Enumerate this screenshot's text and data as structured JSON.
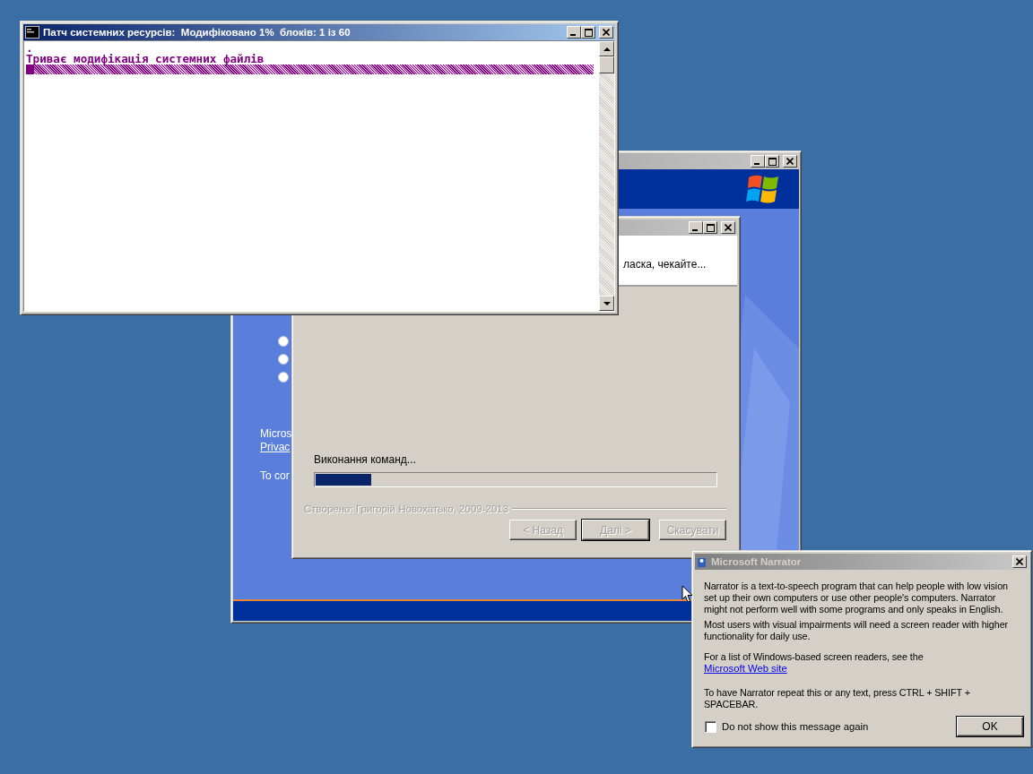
{
  "setup_window": {
    "active": false,
    "options": [
      {
        "selected": false
      },
      {
        "selected": false
      },
      {
        "selected": false
      }
    ],
    "texts": [
      {
        "kind": "text",
        "text": "Micros"
      },
      {
        "kind": "link",
        "text": "Privac"
      },
      {
        "kind": "gap"
      },
      {
        "kind": "text",
        "text": "To cor"
      }
    ]
  },
  "wizard_window": {
    "active": false,
    "header_text": "ласка, чекайте...",
    "status_text": "Виконання команд...",
    "progress": {
      "level": 0.14
    },
    "credit": "Створено: Григорій Новохатько, 2009-2013",
    "buttons": [
      {
        "label": "< Назад",
        "disabled": true,
        "default": false
      },
      {
        "label": "Далі >",
        "disabled": true,
        "default": true
      },
      {
        "label": "Скасувати",
        "disabled": true,
        "default": false
      }
    ]
  },
  "console_window": {
    "active": true,
    "title": "Патч системних ресурсів:  Модифіковано 1%  блоків: 1 із 60",
    "lines": [
      ".",
      "Триває модифікація системних файлів"
    ],
    "progress": {
      "level": 0.015
    }
  },
  "narrator_window": {
    "active": false,
    "title": "Microsoft Narrator",
    "paragraphs": [
      {
        "kind": "text",
        "text": "Narrator is a text-to-speech program that can help people with low vision set up their own computers or use other people's computers. Narrator might not perform well with some programs and only speaks in English."
      },
      {
        "kind": "text",
        "text": "Most users with visual impairments will need a screen reader with higher functionality for daily use."
      },
      {
        "kind": "text",
        "text": "For a list of Windows-based screen readers, see the"
      },
      {
        "kind": "link",
        "text": "Microsoft Web site"
      },
      {
        "kind": "text",
        "text": "To have Narrator repeat this or any text, press CTRL + SHIFT + SPACEBAR."
      }
    ],
    "checkbox": {
      "label": "Do not show this message again",
      "checked": false
    },
    "ok_button": "OK"
  }
}
